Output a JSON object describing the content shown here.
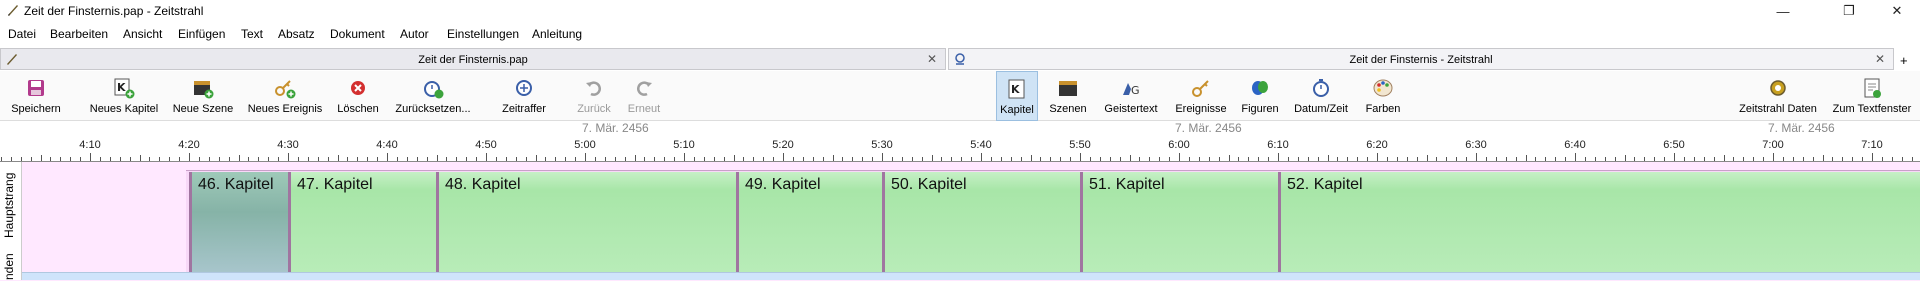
{
  "window": {
    "title": "Zeit der Finsternis.pap -  Zeitstrahl",
    "minimize": "—",
    "maximize": "❐",
    "close": "✕"
  },
  "menu": [
    "Datei",
    "Bearbeiten",
    "Ansicht",
    "Einfügen",
    "Text",
    "Absatz",
    "Dokument",
    "Autor",
    "Einstellungen",
    "Anleitung"
  ],
  "tabs": [
    {
      "title": "Zeit der Finsternis.pap",
      "close": "✕"
    },
    {
      "title": "Zeit der Finsternis - Zeitstrahl",
      "close": "✕"
    }
  ],
  "tab_add": "+",
  "toolbar": {
    "save": "Speichern",
    "new_chapter": "Neues Kapitel",
    "new_scene": "Neue Szene",
    "new_event": "Neues Ereignis",
    "delete": "Löschen",
    "reset": "Zurücksetzen...",
    "time_lapse": "Zeitraffer",
    "back": "Zurück",
    "redo": "Erneut",
    "chapter": "Kapitel",
    "scenes": "Szenen",
    "ghost_text": "Geistertext",
    "events": "Ereignisse",
    "figures": "Figuren",
    "date_time": "Datum/Zeit",
    "colors": "Farben",
    "timeline_data": "Zeitstrahl Daten",
    "to_text_window": "Zum Textfenster"
  },
  "ruler": {
    "dates": [
      "7. Mär. 2456",
      "7. Mär. 2456",
      "7. Mär. 2456"
    ],
    "times": [
      "4:10",
      "4:20",
      "4:30",
      "4:40",
      "4:50",
      "5:00",
      "5:10",
      "5:20",
      "5:30",
      "5:40",
      "5:50",
      "6:00",
      "6:10",
      "6:20",
      "6:30",
      "6:40",
      "6:50",
      "7:00",
      "7:10"
    ]
  },
  "strands": {
    "main": "Hauptstrang",
    "lower": "nden"
  },
  "chapters": [
    {
      "label": "46. Kapitel",
      "selected": true
    },
    {
      "label": "47. Kapitel",
      "selected": false
    },
    {
      "label": "48. Kapitel",
      "selected": false
    },
    {
      "label": "49. Kapitel",
      "selected": false
    },
    {
      "label": "50. Kapitel",
      "selected": false
    },
    {
      "label": "51. Kapitel",
      "selected": false
    },
    {
      "label": "52. Kapitel",
      "selected": false
    }
  ],
  "colors": {
    "chapter_green": "#b8ecb8",
    "chapter_selected": "#9ec9b8",
    "main_strand_bg": "#ffe8ff",
    "lower_strand_bg": "#cfe4fb"
  }
}
